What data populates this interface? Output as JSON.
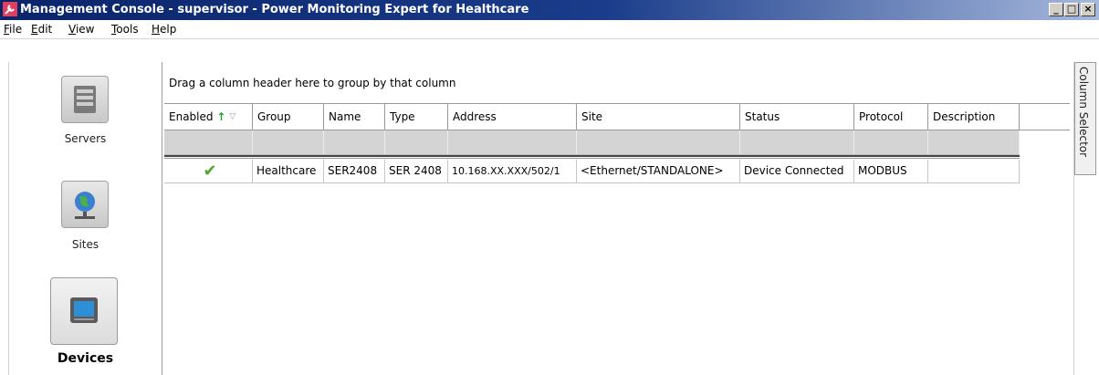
{
  "window": {
    "title": "Management Console - supervisor - Power Monitoring Expert for Healthcare",
    "minimize_glyph": "_",
    "restore_glyph": "□",
    "close_glyph": "×",
    "title_bar_color": "#0a246a",
    "app_icon": "wrench-icon"
  },
  "menu": {
    "items": [
      {
        "accel": "F",
        "rest": "ile"
      },
      {
        "accel": "E",
        "rest": "dit"
      },
      {
        "accel": "V",
        "rest": "iew"
      },
      {
        "accel": "T",
        "rest": "ools"
      },
      {
        "accel": "H",
        "rest": "elp"
      }
    ]
  },
  "nav": {
    "items": [
      {
        "label": "Servers",
        "icon": "servers-icon",
        "selected": false
      },
      {
        "label": "Sites",
        "icon": "globe-network-icon",
        "selected": false
      },
      {
        "label": "Devices",
        "icon": "monitor-device-icon",
        "selected": true
      }
    ]
  },
  "grid": {
    "group_hint": "Drag a column header here to group by that column",
    "columns": [
      "Enabled",
      "Group",
      "Name",
      "Type",
      "Address",
      "Site",
      "Status",
      "Protocol",
      "Description"
    ],
    "sort_indicator": "↑",
    "filter_indicator": "▽",
    "rows": [
      {
        "enabled": "✔",
        "group": "Healthcare",
        "name": "SER2408",
        "type": "SER 2408",
        "address": "10.168.XX.XXX/502/1",
        "site": "<Ethernet/STANDALONE>",
        "status": "Device Connected",
        "protocol": "MODBUS",
        "description": ""
      }
    ]
  },
  "column_selector": {
    "label": "Column Selector"
  }
}
